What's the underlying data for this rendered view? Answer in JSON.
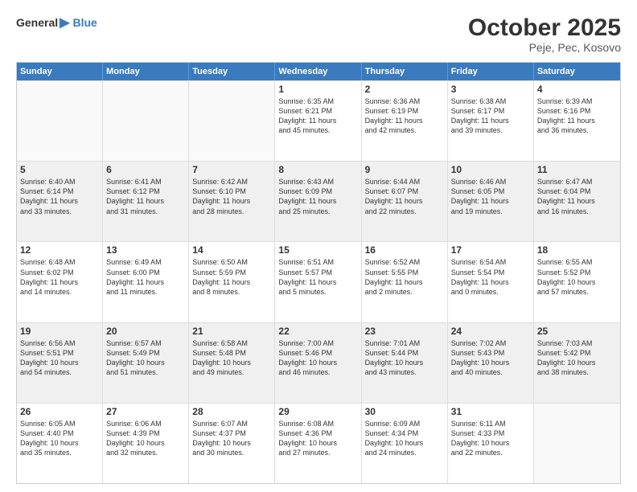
{
  "logo": {
    "general": "General",
    "blue": "Blue",
    "arrow": "▶"
  },
  "title": "October 2025",
  "location": "Peje, Pec, Kosovo",
  "weekdays": [
    "Sunday",
    "Monday",
    "Tuesday",
    "Wednesday",
    "Thursday",
    "Friday",
    "Saturday"
  ],
  "rows": [
    {
      "shade": false,
      "cells": [
        {
          "day": "",
          "lines": []
        },
        {
          "day": "",
          "lines": []
        },
        {
          "day": "",
          "lines": []
        },
        {
          "day": "1",
          "lines": [
            "Sunrise: 6:35 AM",
            "Sunset: 6:21 PM",
            "Daylight: 11 hours",
            "and 45 minutes."
          ]
        },
        {
          "day": "2",
          "lines": [
            "Sunrise: 6:36 AM",
            "Sunset: 6:19 PM",
            "Daylight: 11 hours",
            "and 42 minutes."
          ]
        },
        {
          "day": "3",
          "lines": [
            "Sunrise: 6:38 AM",
            "Sunset: 6:17 PM",
            "Daylight: 11 hours",
            "and 39 minutes."
          ]
        },
        {
          "day": "4",
          "lines": [
            "Sunrise: 6:39 AM",
            "Sunset: 6:16 PM",
            "Daylight: 11 hours",
            "and 36 minutes."
          ]
        }
      ]
    },
    {
      "shade": true,
      "cells": [
        {
          "day": "5",
          "lines": [
            "Sunrise: 6:40 AM",
            "Sunset: 6:14 PM",
            "Daylight: 11 hours",
            "and 33 minutes."
          ]
        },
        {
          "day": "6",
          "lines": [
            "Sunrise: 6:41 AM",
            "Sunset: 6:12 PM",
            "Daylight: 11 hours",
            "and 31 minutes."
          ]
        },
        {
          "day": "7",
          "lines": [
            "Sunrise: 6:42 AM",
            "Sunset: 6:10 PM",
            "Daylight: 11 hours",
            "and 28 minutes."
          ]
        },
        {
          "day": "8",
          "lines": [
            "Sunrise: 6:43 AM",
            "Sunset: 6:09 PM",
            "Daylight: 11 hours",
            "and 25 minutes."
          ]
        },
        {
          "day": "9",
          "lines": [
            "Sunrise: 6:44 AM",
            "Sunset: 6:07 PM",
            "Daylight: 11 hours",
            "and 22 minutes."
          ]
        },
        {
          "day": "10",
          "lines": [
            "Sunrise: 6:46 AM",
            "Sunset: 6:05 PM",
            "Daylight: 11 hours",
            "and 19 minutes."
          ]
        },
        {
          "day": "11",
          "lines": [
            "Sunrise: 6:47 AM",
            "Sunset: 6:04 PM",
            "Daylight: 11 hours",
            "and 16 minutes."
          ]
        }
      ]
    },
    {
      "shade": false,
      "cells": [
        {
          "day": "12",
          "lines": [
            "Sunrise: 6:48 AM",
            "Sunset: 6:02 PM",
            "Daylight: 11 hours",
            "and 14 minutes."
          ]
        },
        {
          "day": "13",
          "lines": [
            "Sunrise: 6:49 AM",
            "Sunset: 6:00 PM",
            "Daylight: 11 hours",
            "and 11 minutes."
          ]
        },
        {
          "day": "14",
          "lines": [
            "Sunrise: 6:50 AM",
            "Sunset: 5:59 PM",
            "Daylight: 11 hours",
            "and 8 minutes."
          ]
        },
        {
          "day": "15",
          "lines": [
            "Sunrise: 6:51 AM",
            "Sunset: 5:57 PM",
            "Daylight: 11 hours",
            "and 5 minutes."
          ]
        },
        {
          "day": "16",
          "lines": [
            "Sunrise: 6:52 AM",
            "Sunset: 5:55 PM",
            "Daylight: 11 hours",
            "and 2 minutes."
          ]
        },
        {
          "day": "17",
          "lines": [
            "Sunrise: 6:54 AM",
            "Sunset: 5:54 PM",
            "Daylight: 11 hours",
            "and 0 minutes."
          ]
        },
        {
          "day": "18",
          "lines": [
            "Sunrise: 6:55 AM",
            "Sunset: 5:52 PM",
            "Daylight: 10 hours",
            "and 57 minutes."
          ]
        }
      ]
    },
    {
      "shade": true,
      "cells": [
        {
          "day": "19",
          "lines": [
            "Sunrise: 6:56 AM",
            "Sunset: 5:51 PM",
            "Daylight: 10 hours",
            "and 54 minutes."
          ]
        },
        {
          "day": "20",
          "lines": [
            "Sunrise: 6:57 AM",
            "Sunset: 5:49 PM",
            "Daylight: 10 hours",
            "and 51 minutes."
          ]
        },
        {
          "day": "21",
          "lines": [
            "Sunrise: 6:58 AM",
            "Sunset: 5:48 PM",
            "Daylight: 10 hours",
            "and 49 minutes."
          ]
        },
        {
          "day": "22",
          "lines": [
            "Sunrise: 7:00 AM",
            "Sunset: 5:46 PM",
            "Daylight: 10 hours",
            "and 46 minutes."
          ]
        },
        {
          "day": "23",
          "lines": [
            "Sunrise: 7:01 AM",
            "Sunset: 5:44 PM",
            "Daylight: 10 hours",
            "and 43 minutes."
          ]
        },
        {
          "day": "24",
          "lines": [
            "Sunrise: 7:02 AM",
            "Sunset: 5:43 PM",
            "Daylight: 10 hours",
            "and 40 minutes."
          ]
        },
        {
          "day": "25",
          "lines": [
            "Sunrise: 7:03 AM",
            "Sunset: 5:42 PM",
            "Daylight: 10 hours",
            "and 38 minutes."
          ]
        }
      ]
    },
    {
      "shade": false,
      "cells": [
        {
          "day": "26",
          "lines": [
            "Sunrise: 6:05 AM",
            "Sunset: 4:40 PM",
            "Daylight: 10 hours",
            "and 35 minutes."
          ]
        },
        {
          "day": "27",
          "lines": [
            "Sunrise: 6:06 AM",
            "Sunset: 4:39 PM",
            "Daylight: 10 hours",
            "and 32 minutes."
          ]
        },
        {
          "day": "28",
          "lines": [
            "Sunrise: 6:07 AM",
            "Sunset: 4:37 PM",
            "Daylight: 10 hours",
            "and 30 minutes."
          ]
        },
        {
          "day": "29",
          "lines": [
            "Sunrise: 6:08 AM",
            "Sunset: 4:36 PM",
            "Daylight: 10 hours",
            "and 27 minutes."
          ]
        },
        {
          "day": "30",
          "lines": [
            "Sunrise: 6:09 AM",
            "Sunset: 4:34 PM",
            "Daylight: 10 hours",
            "and 24 minutes."
          ]
        },
        {
          "day": "31",
          "lines": [
            "Sunrise: 6:11 AM",
            "Sunset: 4:33 PM",
            "Daylight: 10 hours",
            "and 22 minutes."
          ]
        },
        {
          "day": "",
          "lines": []
        }
      ]
    }
  ]
}
